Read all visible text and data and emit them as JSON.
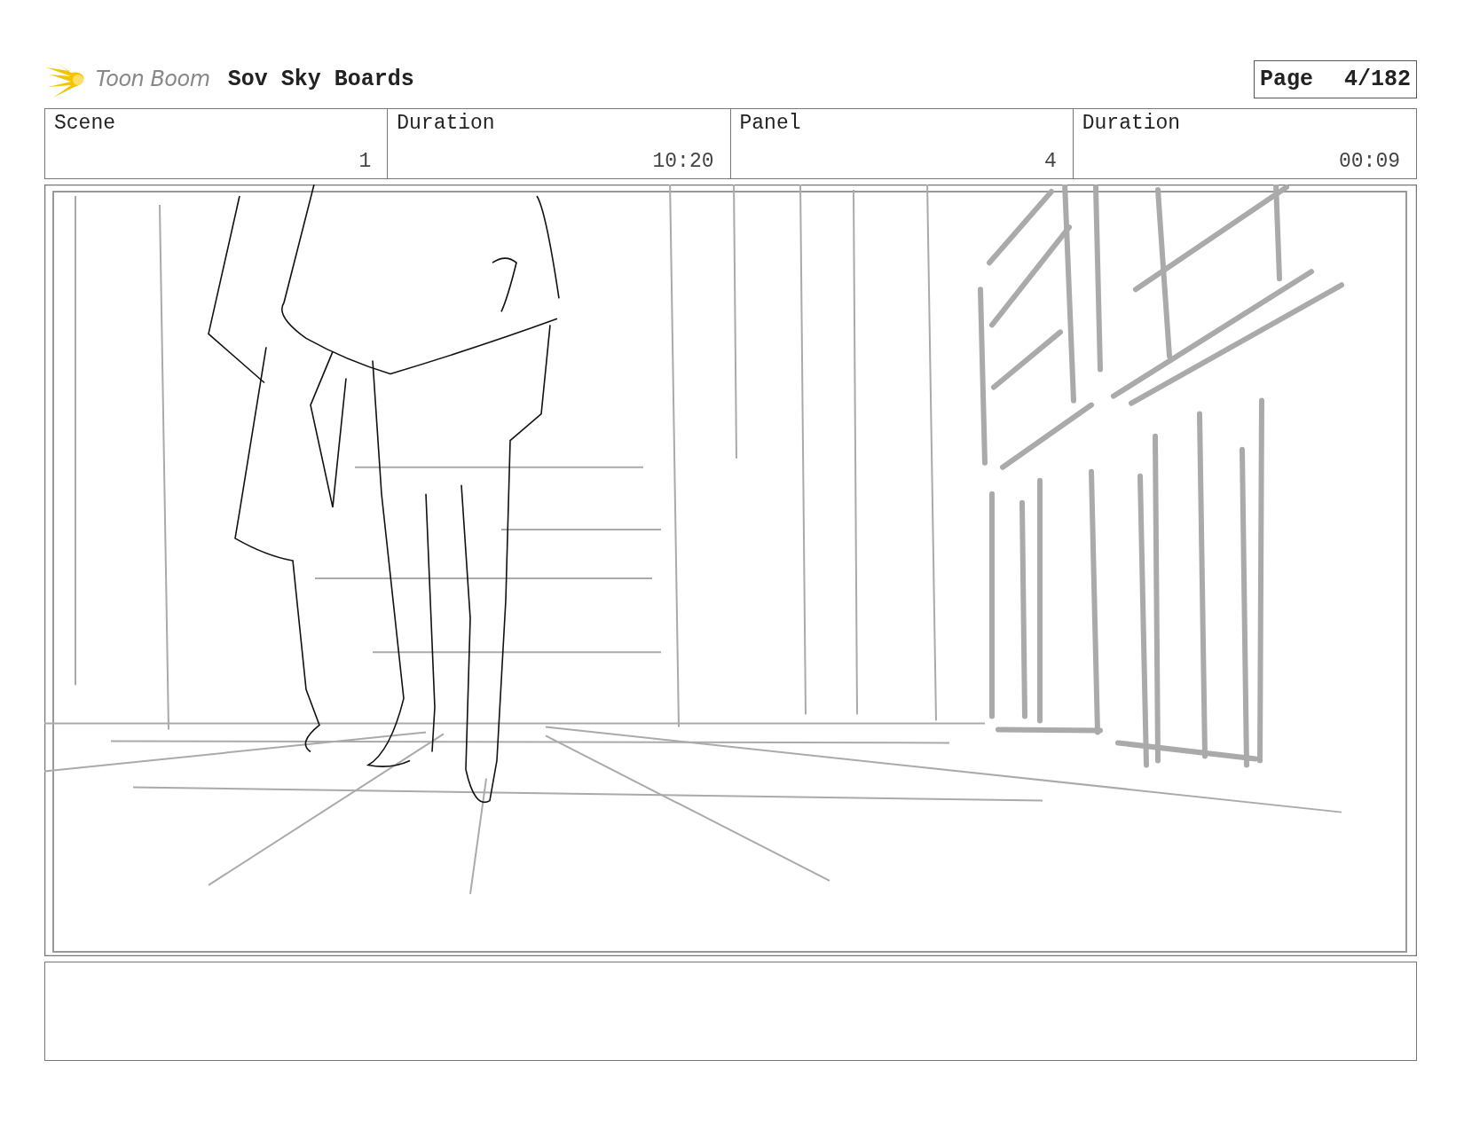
{
  "header": {
    "logo_text": "Toon Boom",
    "project_title": "Sov Sky Boards",
    "page_label": "Page",
    "page_number": "4/182"
  },
  "info_fields": [
    {
      "label": "Scene",
      "value": "1"
    },
    {
      "label": "Duration",
      "value": "10:20"
    },
    {
      "label": "Panel",
      "value": "4"
    },
    {
      "label": "Duration",
      "value": "00:09"
    }
  ]
}
